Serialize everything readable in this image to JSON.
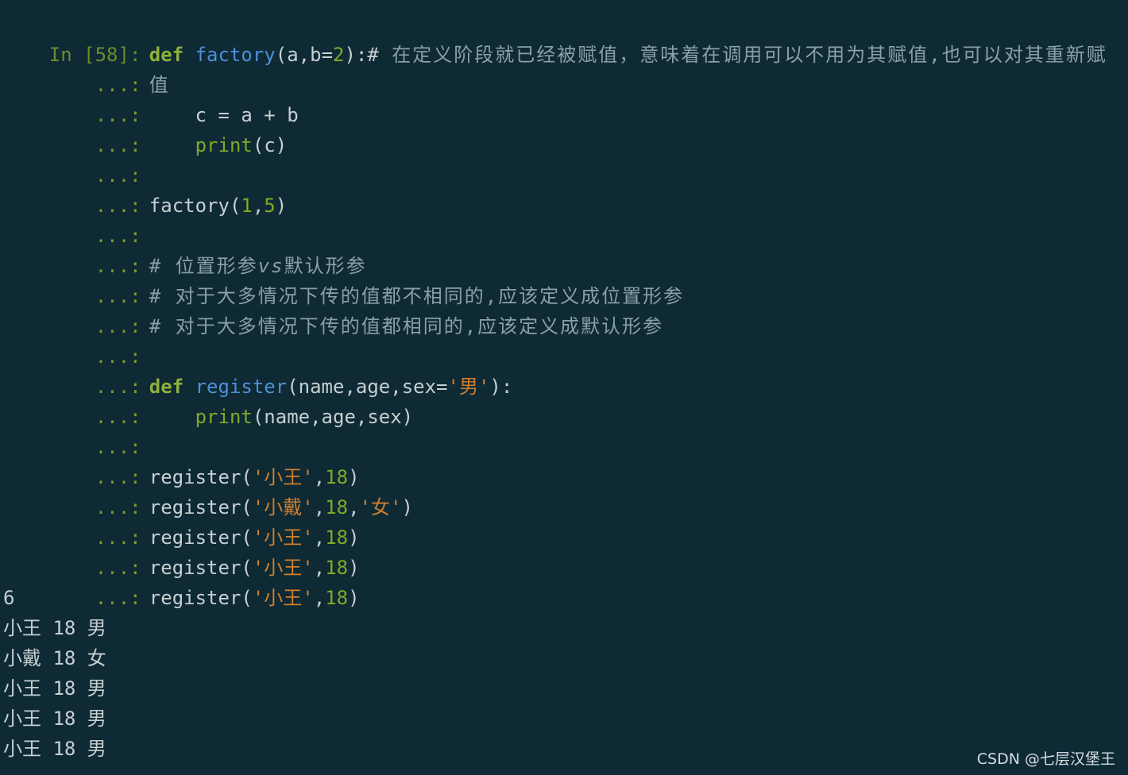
{
  "prompt": {
    "in_label": "In [58]:",
    "cont_label": "...:"
  },
  "code": {
    "l1_kw": "def",
    "l1_fn": "factory",
    "l1_a": "(a,b=",
    "l1_num": "2",
    "l1_b": "):#",
    "l1_comment": " 在定义阶段就已经被赋值，意味着在调用可以不用为其赋值,也可以对其重新赋",
    "l2_comment": "值",
    "l3": "    c = a + b",
    "l4_bi": "print",
    "l4_rest": "(c)",
    "l6_a": "factory(",
    "l6_n1": "1",
    "l6_comma": ",",
    "l6_n2": "5",
    "l6_b": ")",
    "l8_a": "# 位置形参",
    "l8_vs": "vs",
    "l8_b": "默认形参",
    "l9": "# 对于大多情况下传的值都不相同的,应该定义成位置形参",
    "l10": "# 对于大多情况下传的值都相同的,应该定义成默认形参",
    "l12_kw": "def",
    "l12_fn": "register",
    "l12_a": "(name,age,sex=",
    "l12_str": "'男'",
    "l12_b": "):",
    "l13_bi": "print",
    "l13_rest": "(name,age,sex)",
    "reg": "register(",
    "s_wang": "'小王'",
    "s_dai": "'小戴'",
    "s_nv": "'女'",
    "comma": ",",
    "n18": "18",
    "close": ")"
  },
  "output": {
    "o1": "6",
    "o2": "小王 18 男",
    "o3": "小戴 18 女",
    "o4": "小王 18 男",
    "o5": "小王 18 男",
    "o6": "小王 18 男"
  },
  "watermark": "CSDN @七层汉堡王"
}
